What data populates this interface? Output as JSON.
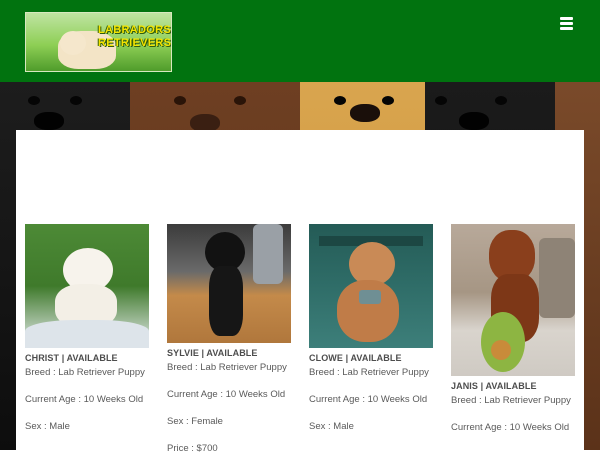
{
  "header": {
    "logo_line1": "LABRADORS",
    "logo_line2": "RETRIEVERS",
    "menu_icon": "hamburger-menu-icon"
  },
  "colors": {
    "header_bg": "#01730f",
    "logo_text": "#f4e400"
  },
  "dogs": [
    {
      "title": "CHRIST | AVAILABLE",
      "breed": "Breed : Lab Retriever Puppy",
      "age": "Current Age : 10 Weeks Old",
      "sex": "Sex : Male"
    },
    {
      "title": "SYLVIE | AVAILABLE",
      "breed": "Breed : Lab Retriever Puppy",
      "age": "Current Age : 10 Weeks Old",
      "sex": "Sex : Female",
      "price": "Price : $700"
    },
    {
      "title": "CLOWE | AVAILABLE",
      "breed": "Breed : Lab Retriever Puppy",
      "age": "Current Age : 10 Weeks Old",
      "sex": "Sex : Male"
    },
    {
      "title": "JANIS | AVAILABLE",
      "breed": "Breed : Lab Retriever Puppy",
      "age": "Current Age : 10 Weeks Old"
    }
  ]
}
